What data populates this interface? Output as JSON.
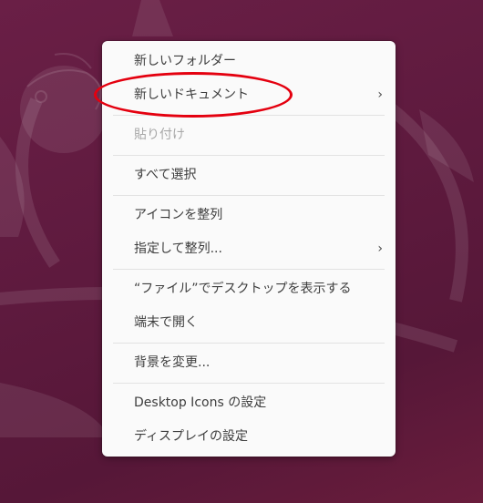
{
  "desktop": {
    "background_color": "#5e1a3e"
  },
  "context_menu": {
    "items": [
      {
        "label": "新しいフォルダー"
      },
      {
        "label": "新しいドキュメント",
        "submenu_icon": "chevron-right-icon"
      },
      {
        "label": "貼り付け",
        "state": "disabled"
      },
      {
        "label": "すべて選択"
      },
      {
        "label": "アイコンを整列"
      },
      {
        "label": "指定して整列...",
        "submenu_icon": "chevron-right-icon"
      },
      {
        "label": "“ファイル”でデスクトップを表示する"
      },
      {
        "label": "端末で開く"
      },
      {
        "label": "背景を変更..."
      },
      {
        "label": "Desktop Icons の設定"
      },
      {
        "label": "ディスプレイの設定"
      }
    ],
    "submenu_arrow_glyph": "›"
  },
  "annotation": {
    "color": "#e4000f",
    "target": "新しいドキュメント"
  }
}
